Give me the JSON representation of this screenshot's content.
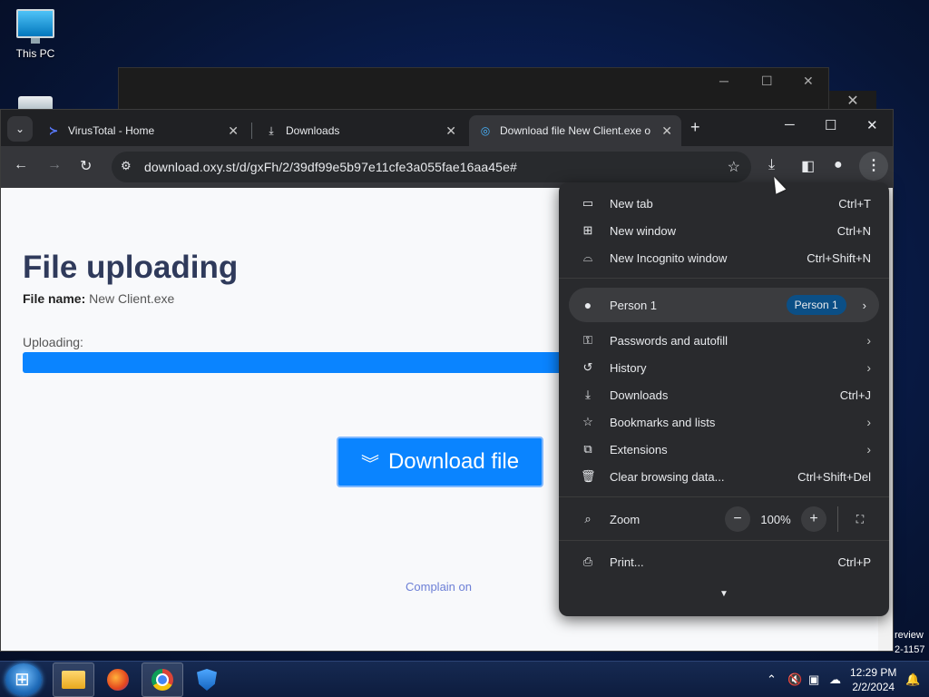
{
  "desktop": {
    "icons": [
      {
        "label": "This PC",
        "icon": "computer-icon"
      }
    ],
    "side_text": [
      "review",
      "2-1157"
    ]
  },
  "browser": {
    "tabs": [
      {
        "title": "VirusTotal - Home",
        "icon": "virustotal-icon",
        "active": false
      },
      {
        "title": "Downloads",
        "icon": "download-icon",
        "active": false
      },
      {
        "title": "Download file New Client.exe o",
        "icon": "site-icon",
        "active": true
      }
    ],
    "url": "download.oxy.st/d/gxFh/2/39df99e5b97e11cfe3a055fae16aa45e#"
  },
  "page": {
    "title": "File uploading",
    "file_name_label": "File name:",
    "file_name": "New Client.exe",
    "uploading_label": "Uploading:",
    "progress": 1.0,
    "download_button": "Download file",
    "complain_link": "Complain on"
  },
  "menu": {
    "top_items": [
      {
        "label": "New tab",
        "shortcut": "Ctrl+T",
        "icon": "new-tab-icon"
      },
      {
        "label": "New window",
        "shortcut": "Ctrl+N",
        "icon": "new-window-icon"
      },
      {
        "label": "New Incognito window",
        "shortcut": "Ctrl+Shift+N",
        "icon": "incognito-icon"
      }
    ],
    "person": {
      "label": "Person 1",
      "badge": "Person 1"
    },
    "mid_items": [
      {
        "label": "Passwords and autofill",
        "shortcut": "",
        "icon": "key-icon",
        "submenu": true
      },
      {
        "label": "History",
        "shortcut": "",
        "icon": "history-icon",
        "submenu": true
      },
      {
        "label": "Downloads",
        "shortcut": "Ctrl+J",
        "icon": "download-icon",
        "submenu": false
      },
      {
        "label": "Bookmarks and lists",
        "shortcut": "",
        "icon": "star-icon",
        "submenu": true
      },
      {
        "label": "Extensions",
        "shortcut": "",
        "icon": "puzzle-icon",
        "submenu": true
      },
      {
        "label": "Clear browsing data...",
        "shortcut": "Ctrl+Shift+Del",
        "icon": "trash-icon",
        "submenu": false
      }
    ],
    "zoom": {
      "label": "Zoom",
      "value": "100%"
    },
    "print": {
      "label": "Print...",
      "shortcut": "Ctrl+P"
    }
  },
  "taskbar": {
    "clock_time": "12:29 PM",
    "clock_date": "2/2/2024",
    "apps": [
      "file-explorer-icon",
      "firefox-icon",
      "chrome-icon",
      "defender-icon"
    ]
  }
}
